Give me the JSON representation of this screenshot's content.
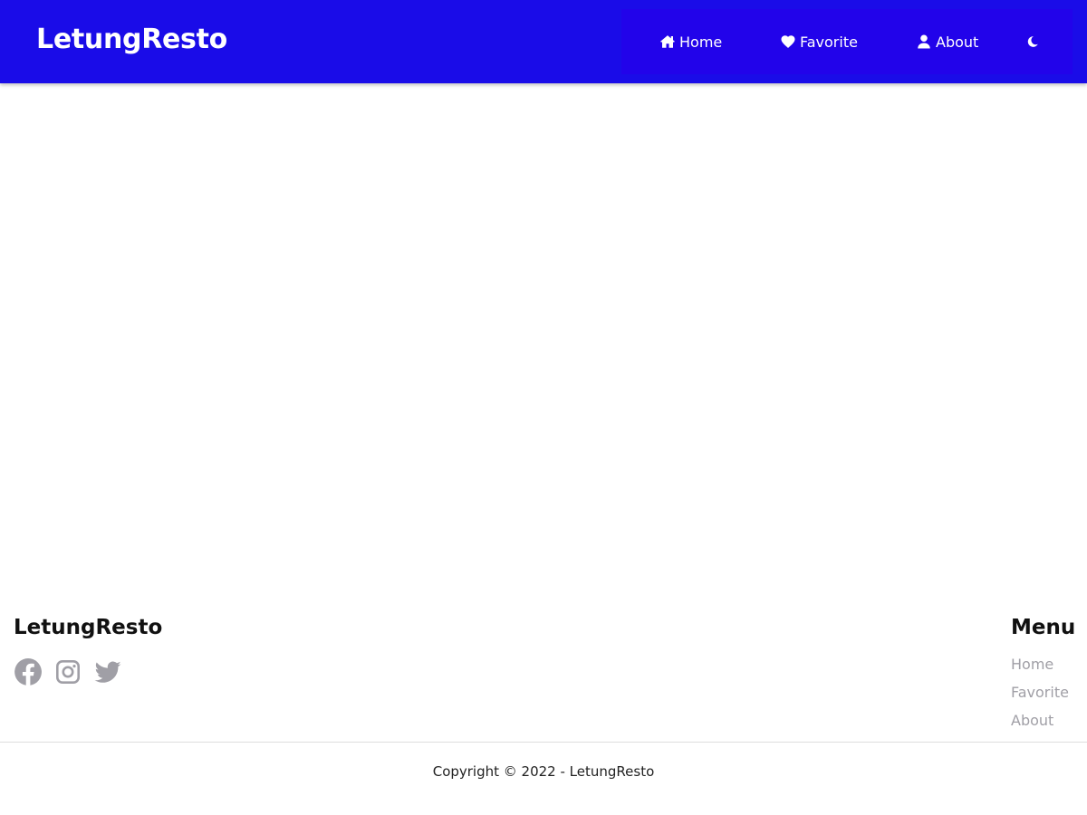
{
  "header": {
    "brand": "LetungResto",
    "nav": [
      {
        "label": "Home",
        "icon": "home-icon"
      },
      {
        "label": "Favorite",
        "icon": "heart-icon"
      },
      {
        "label": "About",
        "icon": "user-icon"
      }
    ],
    "theme_toggle_icon": "moon-icon"
  },
  "footer": {
    "brand": "LetungResto",
    "social": [
      {
        "name": "facebook-icon"
      },
      {
        "name": "instagram-icon"
      },
      {
        "name": "twitter-icon"
      }
    ],
    "menu_title": "Menu",
    "menu": [
      {
        "label": "Home"
      },
      {
        "label": "Favorite"
      },
      {
        "label": "About"
      }
    ],
    "copyright": "Copyright © 2022 - LetungResto"
  },
  "colors": {
    "header_bg": "#1a0ce8",
    "nav_bg": "#2203ea",
    "muted": "#a09fa6"
  }
}
